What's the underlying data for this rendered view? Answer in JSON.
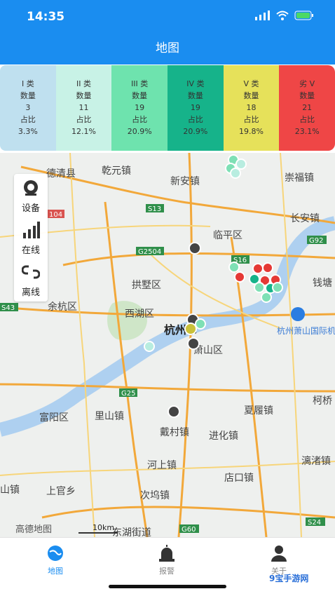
{
  "status": {
    "time": "14:35"
  },
  "title": "地图",
  "stats": [
    {
      "name": "I 类",
      "count_label": "数量",
      "count": "3",
      "ratio_label": "占比",
      "ratio": "3.3%",
      "bg": "#bfe0ef"
    },
    {
      "name": "II 类",
      "count_label": "数量",
      "count": "11",
      "ratio_label": "占比",
      "ratio": "12.1%",
      "bg": "#c8f2e6"
    },
    {
      "name": "III 类",
      "count_label": "数量",
      "count": "19",
      "ratio_label": "占比",
      "ratio": "20.9%",
      "bg": "#6ee3ae"
    },
    {
      "name": "IV 类",
      "count_label": "数量",
      "count": "19",
      "ratio_label": "占比",
      "ratio": "20.9%",
      "bg": "#16b38a"
    },
    {
      "name": "V 类",
      "count_label": "数量",
      "count": "18",
      "ratio_label": "占比",
      "ratio": "19.8%",
      "bg": "#e6e15a"
    },
    {
      "name": "劣 V",
      "count_label": "数量",
      "count": "21",
      "ratio_label": "占比",
      "ratio": "23.1%",
      "bg": "#ef4646"
    }
  ],
  "side": {
    "device": "设备",
    "online": "在线",
    "offline": "离线"
  },
  "map": {
    "labels": [
      "德清县",
      "乾元镇",
      "新安镇",
      "崇福镇",
      "临平区",
      "长安镇",
      "拱墅区",
      "钱塘",
      "余杭区",
      "西湖区",
      "杭州市",
      "萧山区",
      "杭州萧山国际机场",
      "富阳区",
      "里山镇",
      "夏履镇",
      "戴村镇",
      "进化镇",
      "河上镇",
      "漓渚镇",
      "上官乡",
      "次坞镇",
      "店口镇",
      "柯桥",
      "山镇",
      "东湖街道"
    ],
    "roads": [
      "S13",
      "G2504",
      "S16",
      "G92",
      "S43",
      "G25",
      "G60",
      "S24",
      "104"
    ],
    "scale": "10km",
    "logo": "高德地图"
  },
  "tabs": {
    "map": "地图",
    "alarm": "报警",
    "about": "关于"
  },
  "watermark": "9宝手游网"
}
